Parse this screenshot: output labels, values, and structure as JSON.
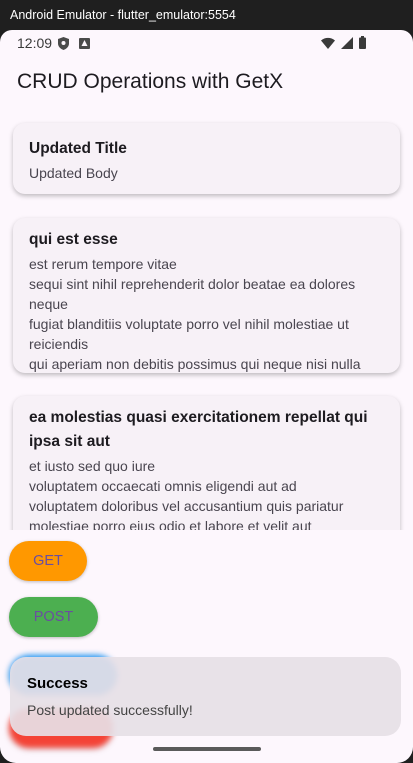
{
  "window": {
    "title": "Android Emulator - flutter_emulator:5554"
  },
  "status_bar": {
    "time": "12:09",
    "left_icons": [
      "shield-icon",
      "sim-download-icon"
    ],
    "right_icons": [
      "wifi-icon",
      "cellular-signal-icon",
      "battery-icon"
    ]
  },
  "app_bar": {
    "title": "CRUD Operations with GetX"
  },
  "posts": [
    {
      "title": "Updated Title",
      "body": "Updated Body"
    },
    {
      "title": "qui est esse",
      "body": "est rerum tempore vitae\nsequi sint nihil reprehenderit dolor beatae ea dolores neque\nfugiat blanditiis voluptate porro vel nihil molestiae ut reiciendis\nqui aperiam non debitis possimus qui neque nisi nulla"
    },
    {
      "title": "ea molestias quasi exercitationem repellat qui ipsa sit aut",
      "body": "et iusto sed quo iure\nvoluptatem occaecati omnis eligendi aut ad\nvoluptatem doloribus vel accusantium quis pariatur\nmolestiae porro eius odio et labore et velit aut"
    }
  ],
  "buttons": {
    "get": {
      "label": "GET",
      "color": "#ff9800"
    },
    "post": {
      "label": "POST",
      "color": "#4caf50"
    },
    "put": {
      "label": "",
      "color": "#2196f3"
    },
    "delete": {
      "label": "",
      "color": "#f44336"
    }
  },
  "snackbar": {
    "title": "Success",
    "message": "Post updated successfully!"
  }
}
